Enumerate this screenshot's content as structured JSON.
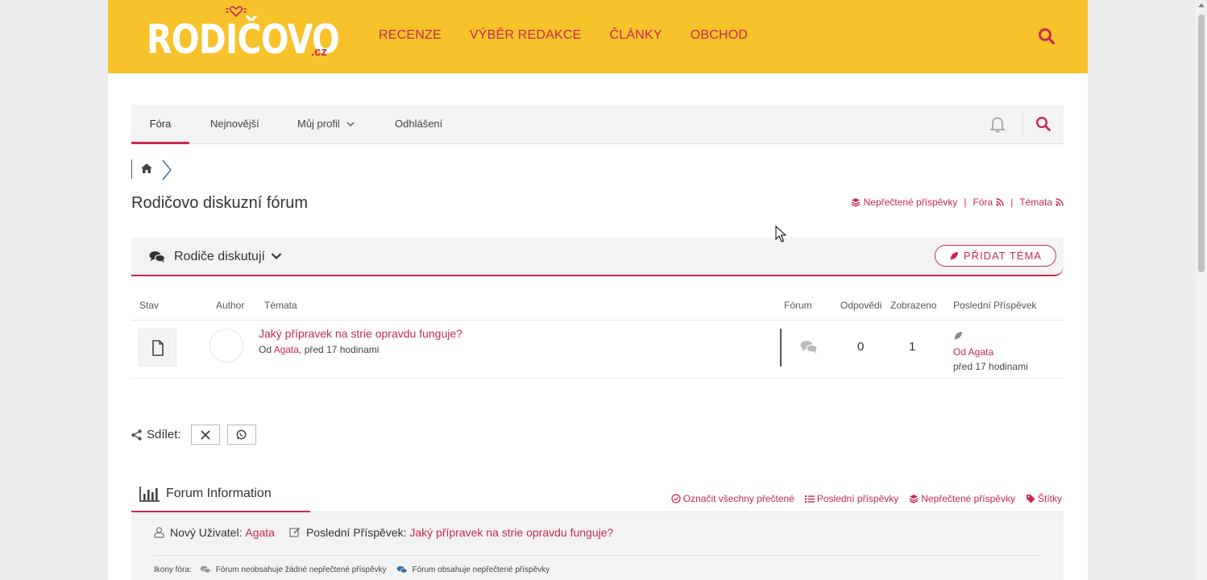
{
  "header": {
    "logo": "RODIČOVO",
    "logo_suffix": ".cz",
    "nav": [
      "RECENZE",
      "VÝBĚR REDAKCE",
      "ČLÁNKY",
      "OBCHOD"
    ]
  },
  "subnav": {
    "items": [
      "Fóra",
      "Nejnovější",
      "Můj profil",
      "Odhlášení"
    ]
  },
  "page": {
    "title": "Rodičovo diskuzní fórum",
    "links": [
      "Nepřečtené příspěvky",
      "Fóra",
      "Témata"
    ],
    "link_separator": "|"
  },
  "category": {
    "title": "Rodiče diskutují",
    "add_topic": "PŘIDAT TÉMA"
  },
  "table": {
    "headers": [
      "Stav",
      "Author",
      "Témata",
      "Fórum",
      "Odpovědi",
      "Zobrazeno",
      "Poslední Příspěvek"
    ],
    "rows": [
      {
        "title": "Jaký přípravek na strie opravdu funguje?",
        "meta_prefix": "Od ",
        "author": "Agata",
        "meta_suffix": ", před 17 hodinami",
        "replies": "0",
        "views": "1",
        "last_by": "Od Agata",
        "last_time": "před 17 hodinami"
      }
    ]
  },
  "share": {
    "label": "Sdílet:"
  },
  "info": {
    "title": "Forum Information",
    "links": [
      "Označit všechny přečtené",
      "Poslední příspěvky",
      "Nepřečtené příspěvky",
      "Štítky"
    ],
    "new_user_label": "Nový Uživatel:",
    "new_user": "Agata",
    "last_post_label": "Poslední Příspěvek:",
    "last_post": "Jaký přípravek na strie opravdu funguje?",
    "legend_label": "Ikony fóra:",
    "legend_read": "Fórum neobsahuje žádné nepřečtené příspěvky",
    "legend_unread": "Fórum obsahuje nepřečtené příspěvky"
  },
  "colors": {
    "accent": "#c8294f",
    "header_bg": "#f8c22b"
  }
}
